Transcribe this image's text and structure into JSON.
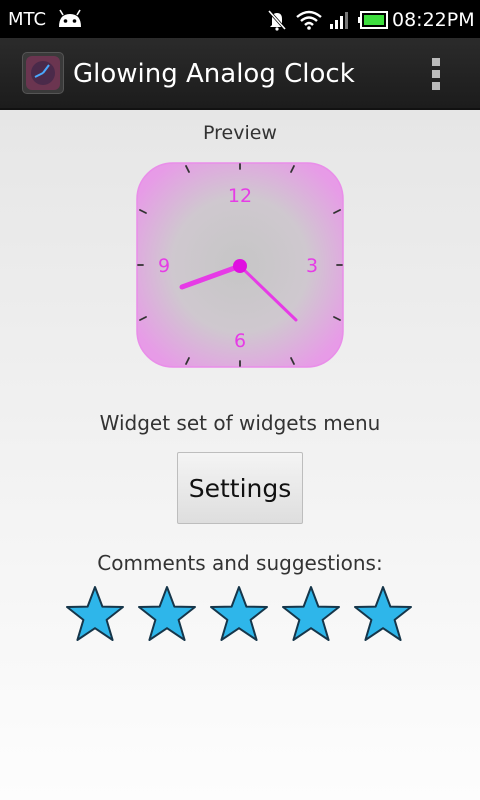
{
  "status_bar": {
    "carrier": "MTC",
    "time": "08:22PM",
    "icons": [
      "android-icon",
      "mute-icon",
      "wifi-icon",
      "signal-icon",
      "battery-icon"
    ]
  },
  "action_bar": {
    "title": "Glowing Analog Clock",
    "icon": "app-clock-icon",
    "overflow_icon": "overflow-menu-icon"
  },
  "preview": {
    "label": "Preview",
    "clock": {
      "numerals": [
        "12",
        "3",
        "6",
        "9"
      ],
      "hour_hand_points_to": "8:15 direction",
      "minute_hand_points_to": "22 minutes",
      "accent_color": "#e63ce6",
      "face_color": "#d7c7d7"
    }
  },
  "widget_caption": "Widget set of widgets menu",
  "settings_button": "Settings",
  "comments_label": "Comments and suggestions:",
  "rating": {
    "stars_count": 5,
    "star_color": "#2eb6ea"
  }
}
